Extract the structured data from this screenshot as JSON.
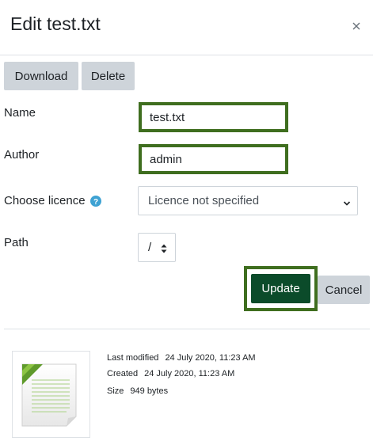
{
  "dialog": {
    "title": "Edit test.txt",
    "close_icon": "close-icon"
  },
  "toolbar": {
    "download_label": "Download",
    "delete_label": "Delete"
  },
  "form": {
    "name_label": "Name",
    "name_value": "test.txt",
    "author_label": "Author",
    "author_value": "admin",
    "licence_label": "Choose licence",
    "licence_help_icon": "help-icon",
    "licence_value": "Licence not specified",
    "path_label": "Path",
    "path_value": "/"
  },
  "actions": {
    "update_label": "Update",
    "cancel_label": "Cancel"
  },
  "file_info": {
    "thumbnail_icon": "text-file-icon",
    "modified_label": "Last modified",
    "modified_value": "24 July 2020, 11:23 AM",
    "created_label": "Created",
    "created_value": "24 July 2020, 11:23 AM",
    "size_label": "Size",
    "size_value": "949 bytes"
  },
  "colors": {
    "primary": "#0b4b2a",
    "highlight": "#3f6e1f",
    "secondary_button": "#ced4da",
    "help_icon": "#3ea2d3"
  }
}
